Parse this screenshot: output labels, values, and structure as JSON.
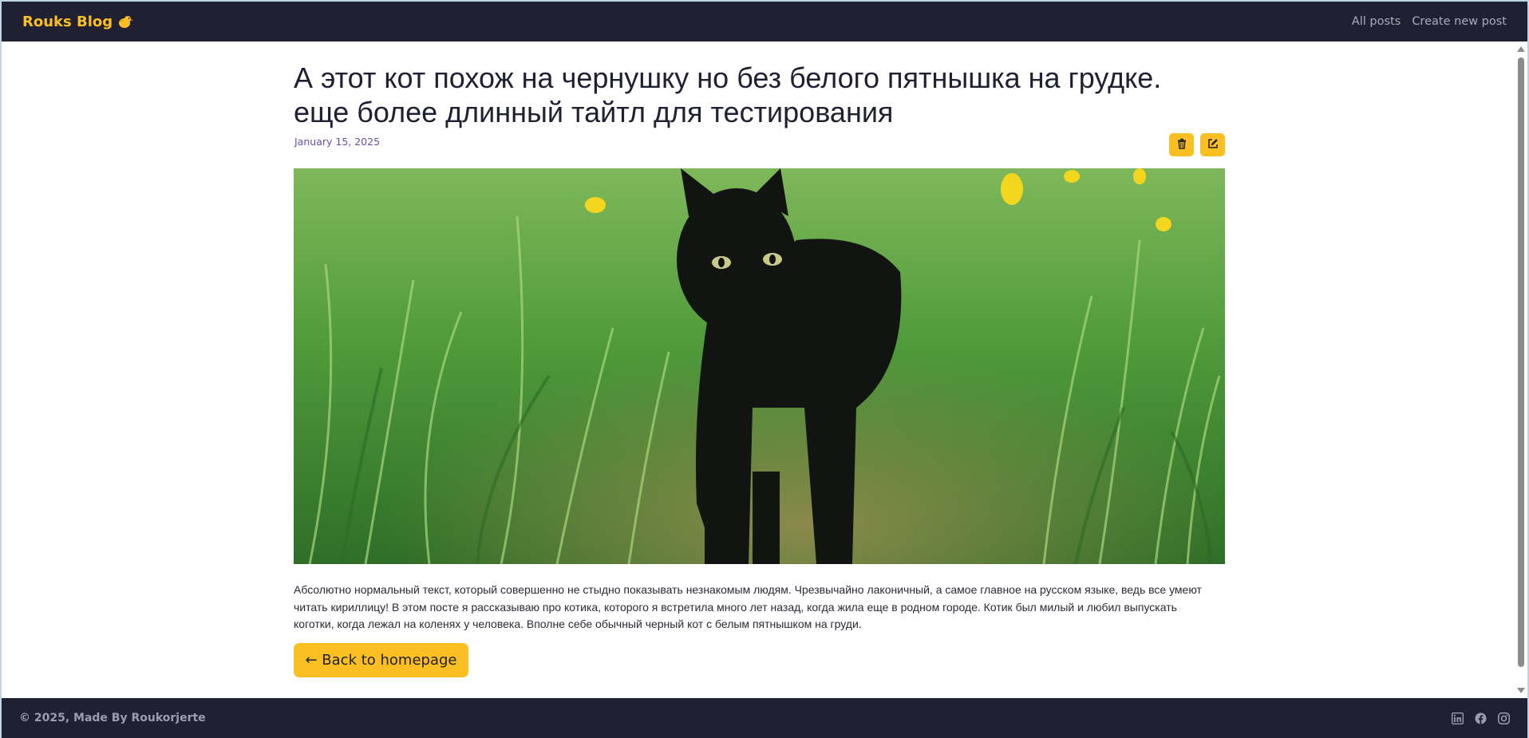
{
  "header": {
    "brand": "Rouks Blog",
    "brand_icon": "chick-icon",
    "nav": [
      {
        "label": "All posts"
      },
      {
        "label": "Create new post"
      }
    ]
  },
  "post": {
    "title": "А этот кот похож на чернушку но без белого пятнышка на грудке. еще более длинный тайтл для тестирования",
    "date": "January 15, 2025",
    "actions": [
      {
        "icon": "trash-icon"
      },
      {
        "icon": "edit-icon"
      }
    ],
    "image_subject": "black cat in green grass",
    "body": "Абсолютно нормальный текст, который совершенно не стыдно показывать незнакомым людям. Чрезвычайно лаконичный, а самое главное на русском языке, ведь все умеют читать кириллицу! В этом посте я рассказываю про котика, которого я встретила много лет назад, когда жила еще в родном городе. Котик был милый и любил выпускать коготки, когда лежал на коленях у человека. Вполне себе обычный черный кот с белым пятнышком на груди.",
    "back_label": "← Back to homepage"
  },
  "footer": {
    "copyright": "© 2025, Made By Roukorjerte",
    "socials": [
      {
        "icon": "linkedin-icon"
      },
      {
        "icon": "facebook-icon"
      },
      {
        "icon": "instagram-icon"
      }
    ]
  },
  "colors": {
    "bar": "#1f2031",
    "accent": "#fbbf24",
    "date": "#6b4fa8"
  }
}
